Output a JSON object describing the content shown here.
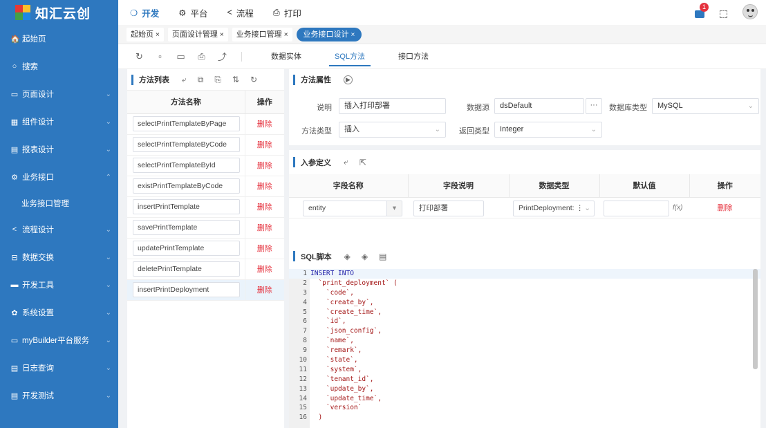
{
  "app": {
    "logo": "知汇云创"
  },
  "sidebar": {
    "items": [
      {
        "icon": "🏠",
        "label": "起始页",
        "chev": ""
      },
      {
        "icon": "○",
        "label": "搜索",
        "chev": ""
      },
      {
        "icon": "▭",
        "label": "页面设计",
        "chev": "⌄"
      },
      {
        "icon": "▦",
        "label": "组件设计",
        "chev": "⌄"
      },
      {
        "icon": "▤",
        "label": "报表设计",
        "chev": "⌄"
      },
      {
        "icon": "⚙",
        "label": "业务接口",
        "chev": "⌃"
      },
      {
        "icon": "",
        "label": "业务接口管理",
        "chev": ""
      },
      {
        "icon": "<",
        "label": "流程设计",
        "chev": "⌄"
      },
      {
        "icon": "⊟",
        "label": "数据交换",
        "chev": "⌄"
      },
      {
        "icon": "▬",
        "label": "开发工具",
        "chev": "⌄"
      },
      {
        "icon": "✿",
        "label": "系统设置",
        "chev": "⌄"
      },
      {
        "icon": "▭",
        "label": "myBuilder平台服务",
        "chev": "⌄"
      },
      {
        "icon": "▤",
        "label": "日志查询",
        "chev": "⌄"
      },
      {
        "icon": "▤",
        "label": "开发测试",
        "chev": "⌄"
      }
    ]
  },
  "topnav": [
    {
      "icon": "❍",
      "label": "开发"
    },
    {
      "icon": "⚙",
      "label": "平台"
    },
    {
      "icon": "<",
      "label": "流程"
    },
    {
      "icon": "⎙",
      "label": "打印"
    }
  ],
  "notifications": {
    "count": "1"
  },
  "tabs": [
    {
      "label": "起始页",
      "close": "×"
    },
    {
      "label": "页面设计管理",
      "close": "×"
    },
    {
      "label": "业务接口管理",
      "close": "×"
    },
    {
      "label": "业务接口设计",
      "close": "×"
    }
  ],
  "toolbar": {
    "icons": [
      "↻",
      "▫",
      "▭",
      "⎙",
      "⤴"
    ],
    "subtabs": [
      "数据实体",
      "SQL方法",
      "接口方法"
    ]
  },
  "methods": {
    "title": "方法列表",
    "icons": [
      "⤶",
      "⧉",
      "⎘",
      "⇅",
      "↻"
    ],
    "col_name": "方法名称",
    "col_op": "操作",
    "delete_label": "删除",
    "rows": [
      "selectPrintTemplateByPage",
      "selectPrintTemplateByCode",
      "selectPrintTemplateById",
      "existPrintTemplateByCode",
      "insertPrintTemplate",
      "savePrintTemplate",
      "updatePrintTemplate",
      "deletePrintTemplate",
      "insertPrintDeployment"
    ]
  },
  "props": {
    "title": "方法属性",
    "play_icon": "▶",
    "desc_label": "说明",
    "desc_value": "插入打印部署",
    "ds_label": "数据源",
    "ds_value": "dsDefault",
    "ds_btn": "···",
    "dbtype_label": "数据库类型",
    "dbtype_value": "MySQL",
    "mtype_label": "方法类型",
    "mtype_value": "插入",
    "rtype_label": "返回类型",
    "rtype_value": "Integer",
    "dropdown": "⌄"
  },
  "params": {
    "title": "入参定义",
    "icons": [
      "⤶",
      "⇱"
    ],
    "cols": [
      "字段名称",
      "字段说明",
      "数据类型",
      "默认值",
      "操作"
    ],
    "row": {
      "name": "entity",
      "desc": "打印部署",
      "type": "PrintDeployment: ⋮",
      "default": "",
      "fx": "f(x)",
      "op": "删除",
      "caret": "▾"
    }
  },
  "sql": {
    "title": "SQL脚本",
    "icons": [
      "◈",
      "◈",
      "▤"
    ],
    "lines": [
      {
        "n": "1",
        "t": "INSERT INTO",
        "kw": true
      },
      {
        "n": "2",
        "t": "  `print_deployment` (",
        "kw": false
      },
      {
        "n": "3",
        "t": "    `code`,",
        "kw": false
      },
      {
        "n": "4",
        "t": "    `create_by`,",
        "kw": false
      },
      {
        "n": "5",
        "t": "    `create_time`,",
        "kw": false
      },
      {
        "n": "6",
        "t": "    `id`,",
        "kw": false
      },
      {
        "n": "7",
        "t": "    `json_config`,",
        "kw": false
      },
      {
        "n": "8",
        "t": "    `name`,",
        "kw": false
      },
      {
        "n": "9",
        "t": "    `remark`,",
        "kw": false
      },
      {
        "n": "10",
        "t": "    `state`,",
        "kw": false
      },
      {
        "n": "11",
        "t": "    `system`,",
        "kw": false
      },
      {
        "n": "12",
        "t": "    `tenant_id`,",
        "kw": false
      },
      {
        "n": "13",
        "t": "    `update_by`,",
        "kw": false
      },
      {
        "n": "14",
        "t": "    `update_time`,",
        "kw": false
      },
      {
        "n": "15",
        "t": "    `version`",
        "kw": false
      },
      {
        "n": "16",
        "t": "  )",
        "kw": false
      }
    ]
  },
  "colors": {
    "primary": "#2e78bf",
    "danger": "#e5323e"
  }
}
